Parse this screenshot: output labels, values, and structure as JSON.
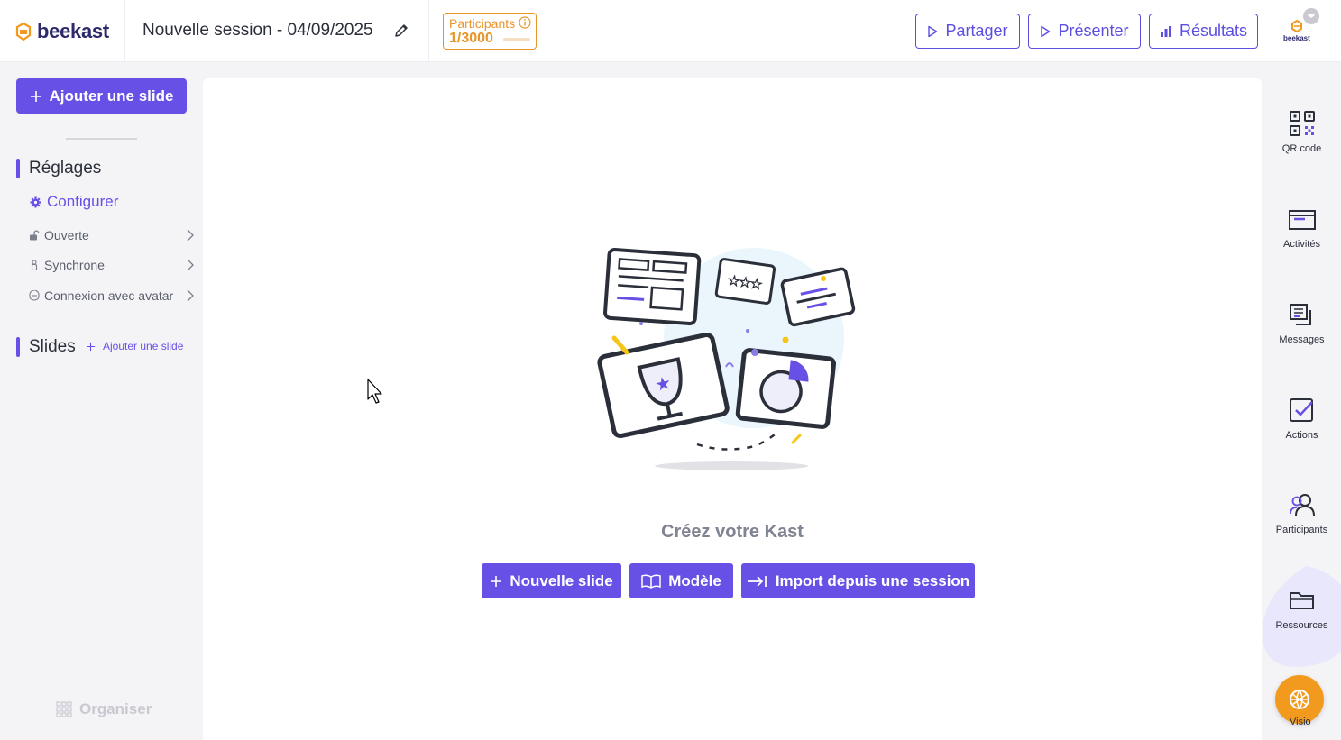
{
  "app": {
    "logo_text": "beekast",
    "session_title": "Nouvelle session - 04/09/2025",
    "brand_color": "#6650e6",
    "accent_color": "#f29a1e"
  },
  "participants": {
    "label": "Participants",
    "count": "1/3000"
  },
  "header_buttons": {
    "share": "Partager",
    "present": "Présenter",
    "results": "Résultats"
  },
  "avatar": {
    "logo_text": "beekast"
  },
  "sidebar": {
    "add_slide": "Ajouter une slide",
    "settings_title": "Réglages",
    "configure": "Configurer",
    "settings": [
      {
        "label": "Ouverte",
        "icon": "unlock-icon"
      },
      {
        "label": "Synchrone",
        "icon": "person-icon"
      },
      {
        "label": "Connexion avec avatar",
        "icon": "avatar-mask-icon"
      }
    ],
    "slides_title": "Slides",
    "add_slide_inline": "Ajouter une slide",
    "organise": "Organiser"
  },
  "main": {
    "empty_title": "Créez votre Kast",
    "buttons": {
      "new_slide": "Nouvelle slide",
      "template": "Modèle",
      "import": "Import depuis une session"
    }
  },
  "right_sidebar": {
    "items": [
      {
        "label": "QR code",
        "icon": "qr-code-icon"
      },
      {
        "label": "Activités",
        "icon": "activities-icon"
      },
      {
        "label": "Messages",
        "icon": "messages-icon"
      },
      {
        "label": "Actions",
        "icon": "actions-checkbox-icon"
      },
      {
        "label": "Participants",
        "icon": "participants-icon"
      },
      {
        "label": "Ressources",
        "icon": "folder-icon"
      }
    ],
    "visio": "Visio"
  }
}
